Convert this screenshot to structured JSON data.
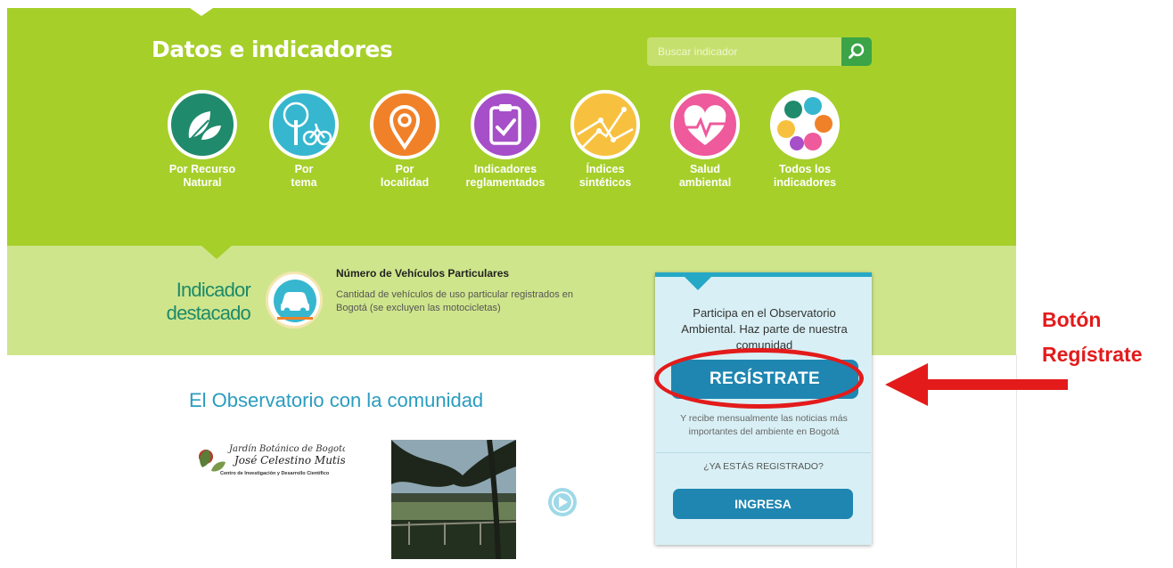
{
  "header": {
    "title": "Datos e indicadores",
    "search_placeholder": "Buscar indicador"
  },
  "categories": [
    {
      "label": "Por Recurso\nNatural",
      "icon": "leaves-icon",
      "color": "#1f8a6c"
    },
    {
      "label": "Por\ntema",
      "icon": "tree-bike-icon",
      "color": "#36b7cf"
    },
    {
      "label": "Por\nlocalidad",
      "icon": "location-pin-icon",
      "color": "#f08129"
    },
    {
      "label": "Indicadores\nreglamentados",
      "icon": "clipboard-check-icon",
      "color": "#a64fc8"
    },
    {
      "label": "Índices\nsintéticos",
      "icon": "graph-network-icon",
      "color": "#f7c13f"
    },
    {
      "label": "Salud\nambiental",
      "icon": "heart-pulse-icon",
      "color": "#ee5a9c"
    },
    {
      "label": "Todos los\nindicadores",
      "icon": "colorful-blobs-icon",
      "color": "#ffffff"
    }
  ],
  "featured": {
    "title": "Indicador destacado",
    "title_line1": "Indicador",
    "title_line2": "destacado",
    "name": "Número de Vehículos Particulares",
    "description": "Cantidad de vehículos de uso particular registrados en Bogotá (se excluyen las motocicletas)",
    "icon": "car-icon"
  },
  "community": {
    "title": "El Observatorio con la comunidad",
    "partner_logo_line1": "Jardín Botánico de Bogotá",
    "partner_logo_line2": "José Celestino Mutis",
    "partner_logo_line3": "Centro de Investigación y Desarrollo Científico"
  },
  "register_panel": {
    "intro": "Participa en el Observatorio Ambiental. Haz parte de nuestra comunidad",
    "register_label": "REGÍSTRATE",
    "register_sub": "Y recibe mensualmente las noticias más importantes del ambiente en Bogotá",
    "already_registered": "¿YA ESTÁS REGISTRADO?",
    "login_label": "INGRESA"
  },
  "annotation": {
    "line1": "Botón",
    "line2": "Regístrate",
    "color": "#e31b1b"
  },
  "colors": {
    "green_band": "#a6cf2a",
    "light_band": "#cfe58c",
    "accent_blue": "#1f86b1",
    "panel_bg": "#d8f0f5"
  }
}
